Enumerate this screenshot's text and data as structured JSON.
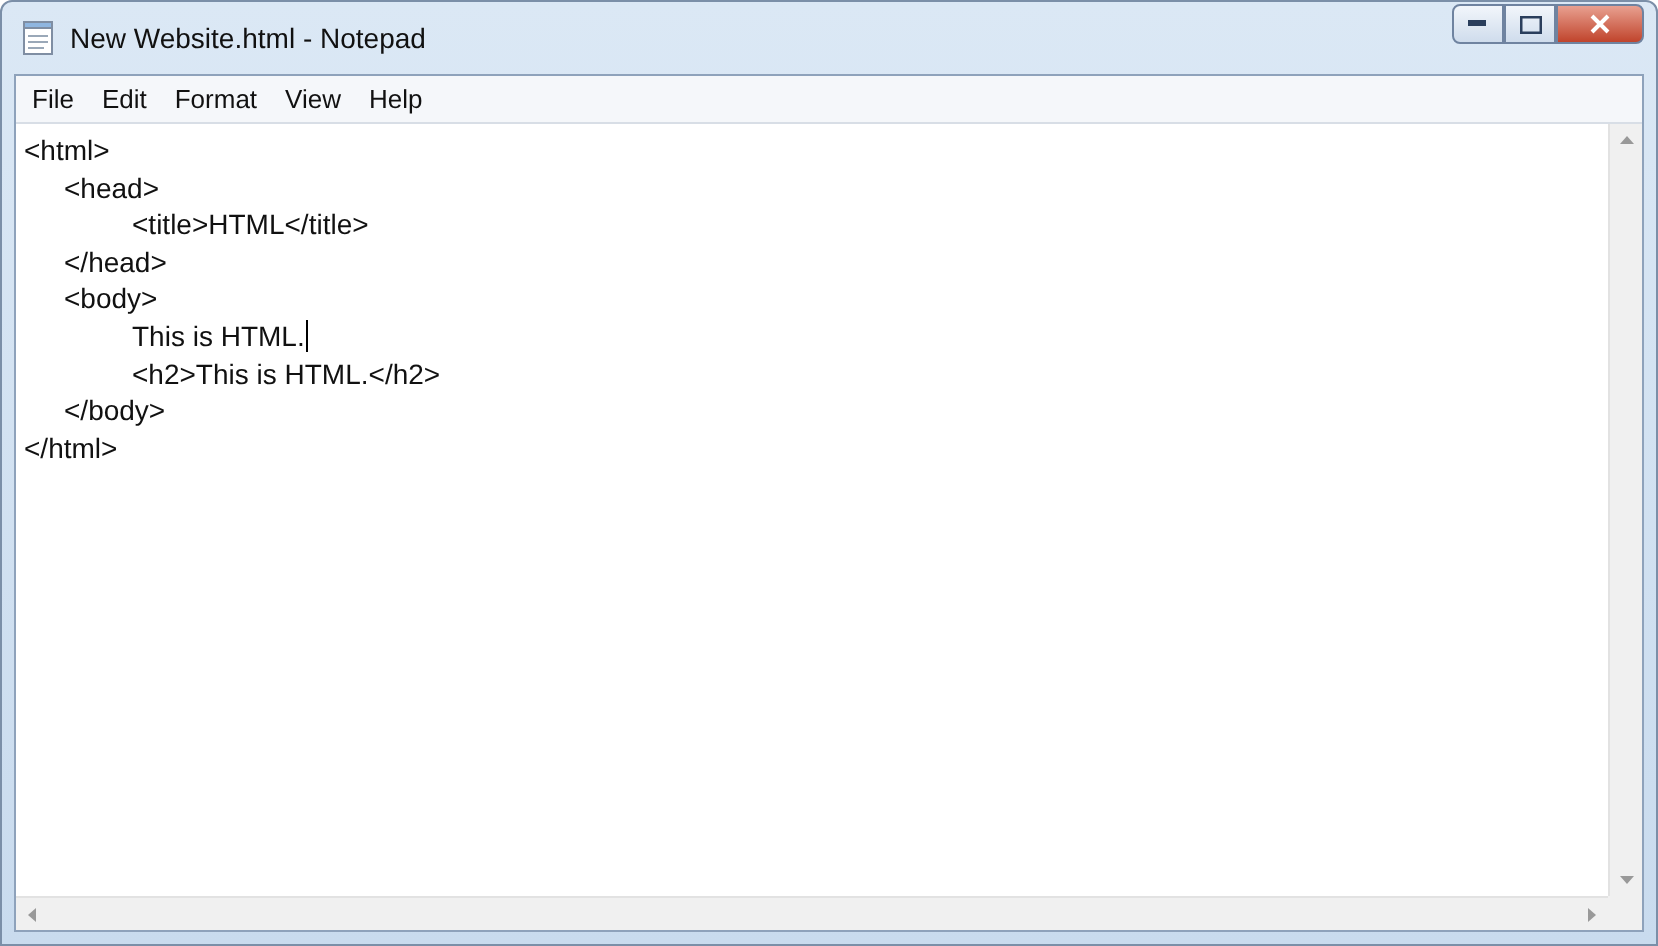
{
  "window": {
    "title": "New Website.html - Notepad"
  },
  "menu": [
    "File",
    "Edit",
    "Format",
    "View",
    "Help"
  ],
  "editor": {
    "lines": [
      {
        "text": "<html>",
        "children": [
          {
            "text": "<head>",
            "children": [
              {
                "text": "<title>HTML</title>"
              }
            ]
          },
          {
            "text": "</head>"
          },
          {
            "text": "<body>",
            "children": [
              {
                "text": "This is HTML.",
                "cursor": true
              },
              {
                "text": "<h2>This is HTML.</h2>"
              }
            ]
          },
          {
            "text": "</body>"
          }
        ]
      },
      {
        "text": "</html>"
      }
    ]
  }
}
